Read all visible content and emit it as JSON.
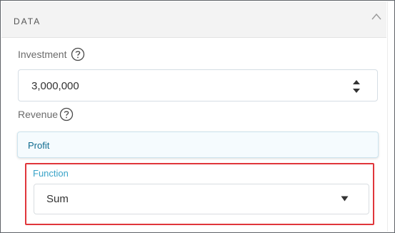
{
  "section": {
    "title": "DATA",
    "collapse_icon": "chevron-up-icon"
  },
  "investment": {
    "label": "Investment",
    "help_icon": "question-circle-icon",
    "value": "3,000,000",
    "stepper_icon": "up-down-stepper-icon"
  },
  "revenue": {
    "label": "Revenue",
    "help_icon": "question-circle-icon"
  },
  "profit": {
    "label": "Profit"
  },
  "function": {
    "label": "Function",
    "selected": "Sum",
    "dropdown_icon": "caret-down-icon"
  },
  "colors": {
    "accent": "#39a3c8",
    "profit_text": "#0f6b8f",
    "highlight": "#e0363b",
    "header_bg": "#f3f3f3"
  }
}
